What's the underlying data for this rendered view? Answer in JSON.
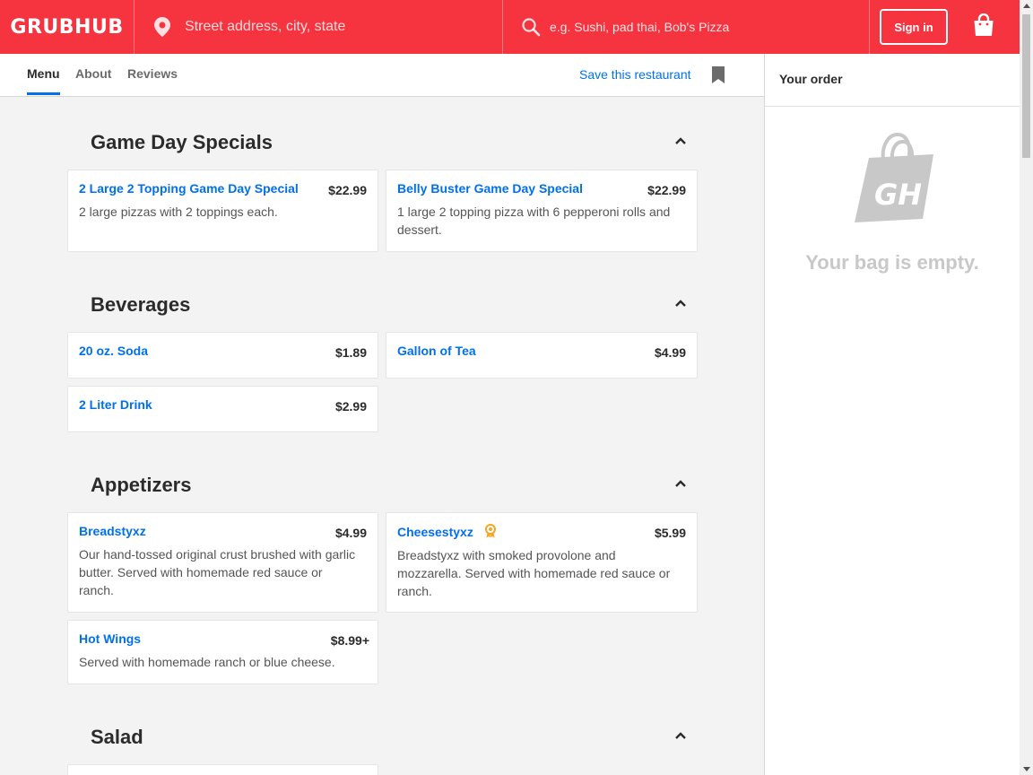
{
  "header": {
    "logo": "GRUBHUB",
    "address_placeholder": "Street address, city, state",
    "search_placeholder": "e.g. Sushi, pad thai, Bob's Pizza",
    "signin_label": "Sign in",
    "brand_color": "#f63440"
  },
  "tabs": [
    {
      "label": "Menu",
      "active": true
    },
    {
      "label": "About",
      "active": false
    },
    {
      "label": "Reviews",
      "active": false
    }
  ],
  "save_label": "Save this restaurant",
  "sections": [
    {
      "title": "Game Day Specials",
      "items": [
        {
          "name": "2 Large 2 Topping Game Day Special",
          "price": "$22.99",
          "desc": "2 large pizzas with 2 toppings each."
        },
        {
          "name": "Belly Buster Game Day Special",
          "price": "$22.99",
          "desc": "1 large 2 topping pizza with 6 pepperoni rolls and dessert."
        }
      ]
    },
    {
      "title": "Beverages",
      "items": [
        {
          "name": "20 oz. Soda",
          "price": "$1.89",
          "desc": ""
        },
        {
          "name": "Gallon of Tea",
          "price": "$4.99",
          "desc": ""
        },
        {
          "name": "2 Liter Drink",
          "price": "$2.99",
          "desc": ""
        }
      ]
    },
    {
      "title": "Appetizers",
      "items": [
        {
          "name": "Breadstyxz",
          "price": "$4.99",
          "desc": "Our hand-tossed original crust brushed with garlic butter. Served with homemade red sauce or ranch."
        },
        {
          "name": "Cheesestyxz",
          "price": "$5.99",
          "desc": "Breadstyxz with smoked provolone and mozzarella. Served with homemade red sauce or ranch.",
          "icon": "award-ribbon-icon"
        },
        {
          "name": "Hot Wings",
          "price": "$8.99+",
          "desc": "Served with homemade ranch or blue cheese."
        }
      ]
    },
    {
      "title": "Salad",
      "items": []
    }
  ],
  "order_panel": {
    "title": "Your order",
    "empty_text": "Your bag is empty.",
    "bag_monogram": "GH"
  },
  "colors": {
    "link": "#0070eb",
    "award": "#f5a623"
  }
}
